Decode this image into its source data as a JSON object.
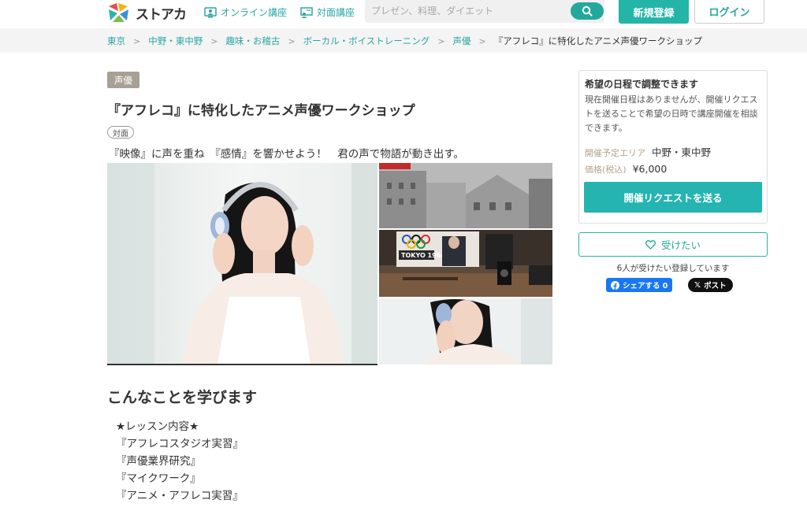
{
  "header": {
    "logo_text": "ストアカ",
    "nav_online": "オンライン講座",
    "nav_offline": "対面講座",
    "search_placeholder": "プレゼン、料理、ダイエット",
    "register_label": "新規登録",
    "login_label": "ログイン",
    "accent_color": "#25a89c"
  },
  "breadcrumb": [
    "東京",
    "中野・東中野",
    "趣味・お稽古",
    "ボーカル・ボイストレーニング",
    "声優",
    "『アフレコ』に特化したアニメ声優ワークショップ"
  ],
  "course": {
    "category_tag": "声優",
    "title": "『アフレコ』に特化したアニメ声優ワークショップ",
    "type_badge": "対面",
    "subtitle": "『映像』に声を重ね　『感情』を響かせよう！　君の声で物語が動き出す。",
    "photo_thumb2_text": "TOKYO 1964"
  },
  "learn": {
    "heading": "こんなことを学びます",
    "items": [
      "★レッスン内容★",
      "『アフレコスタジオ実習』",
      "『声優業界研究』",
      "『マイクワーク』",
      "『アニメ・アフレコ実習』"
    ]
  },
  "sidebar": {
    "title": "希望の日程で調整できます",
    "description": "現在開催日程はありませんが、開催リクエストを送ることで希望の日時で講座開催を相談できます。",
    "area_label": "開催予定エリア",
    "area_value": "中野・東中野",
    "price_label": "価格(税込)",
    "price_value": "¥6,000",
    "request_button": "開催リクエストを送る",
    "want_button": "受けたい",
    "want_count_text": "6人が受けたい登録しています",
    "facebook_share": "シェアする 0",
    "x_post": "ポスト"
  }
}
